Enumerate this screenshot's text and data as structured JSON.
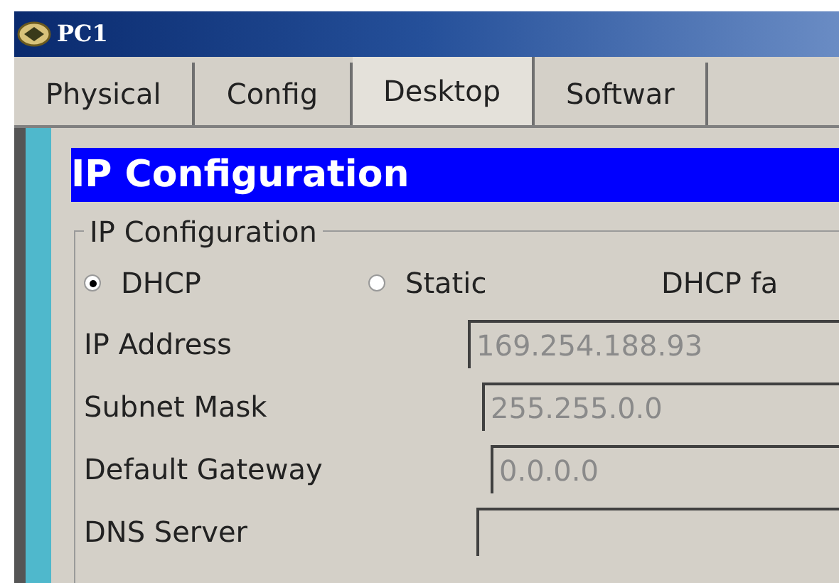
{
  "window": {
    "title": "PC1"
  },
  "tabs": [
    {
      "label": "Physical",
      "selected": false
    },
    {
      "label": "Config",
      "selected": false
    },
    {
      "label": "Desktop",
      "selected": true
    },
    {
      "label": "Softwar",
      "selected": false
    }
  ],
  "panel": {
    "title": "IP Configuration",
    "group_title": "IP Configuration",
    "modes": [
      {
        "label": "DHCP",
        "selected": true
      },
      {
        "label": "Static",
        "selected": false
      }
    ],
    "status": "DHCP fa",
    "fields": [
      {
        "label": "IP Address",
        "value": "169.254.188.93",
        "disabled": true
      },
      {
        "label": "Subnet Mask",
        "value": "255.255.0.0",
        "disabled": true
      },
      {
        "label": "Default Gateway",
        "value": "0.0.0.0",
        "disabled": true
      },
      {
        "label": "DNS Server",
        "disabled": true
      }
    ]
  }
}
